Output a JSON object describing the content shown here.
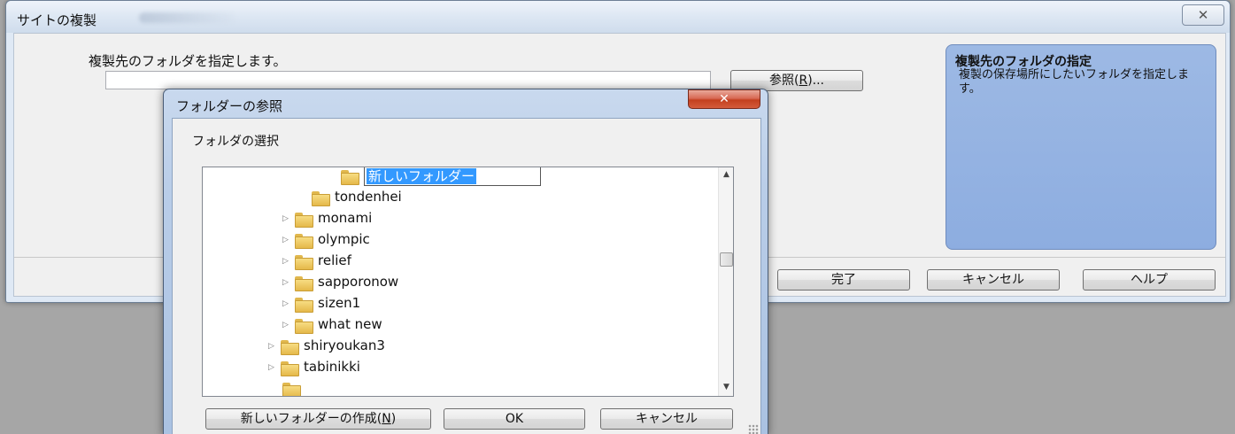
{
  "main_window": {
    "title": "サイトの複製",
    "close_glyph": "✕",
    "prompt_label": "複製先のフォルダを指定します。",
    "path_value": "",
    "browse_button": "参照(R)...",
    "browse_button_pre": "参照(",
    "browse_button_key": "R",
    "browse_button_post": ")...",
    "help_panel": {
      "title": "複製先のフォルダの指定",
      "description": "複製の保存場所にしたいフォルダを指定します。"
    },
    "buttons": {
      "finish": "完了",
      "cancel": "キャンセル",
      "help": "ヘルプ"
    }
  },
  "browse_dialog": {
    "title": "フォルダーの参照",
    "close_glyph": "✕",
    "select_label": "フォルダの選択",
    "tree": {
      "editing_item": "新しいフォルダー",
      "items": [
        {
          "label": "tondenhei",
          "expandable": false
        },
        {
          "label": "monami",
          "expandable": true
        },
        {
          "label": "olympic",
          "expandable": true
        },
        {
          "label": "relief",
          "expandable": true
        },
        {
          "label": "sapporonow",
          "expandable": true
        },
        {
          "label": "sizen1",
          "expandable": true
        },
        {
          "label": "what new",
          "expandable": true
        },
        {
          "label": "shiryoukan3",
          "expandable": true
        },
        {
          "label": "tabinikki",
          "expandable": true
        }
      ]
    },
    "buttons": {
      "new_folder_pre": "新しいフォルダーの作成(",
      "new_folder_key": "N",
      "new_folder_post": ")",
      "ok": "OK",
      "cancel": "キャンセル"
    }
  }
}
